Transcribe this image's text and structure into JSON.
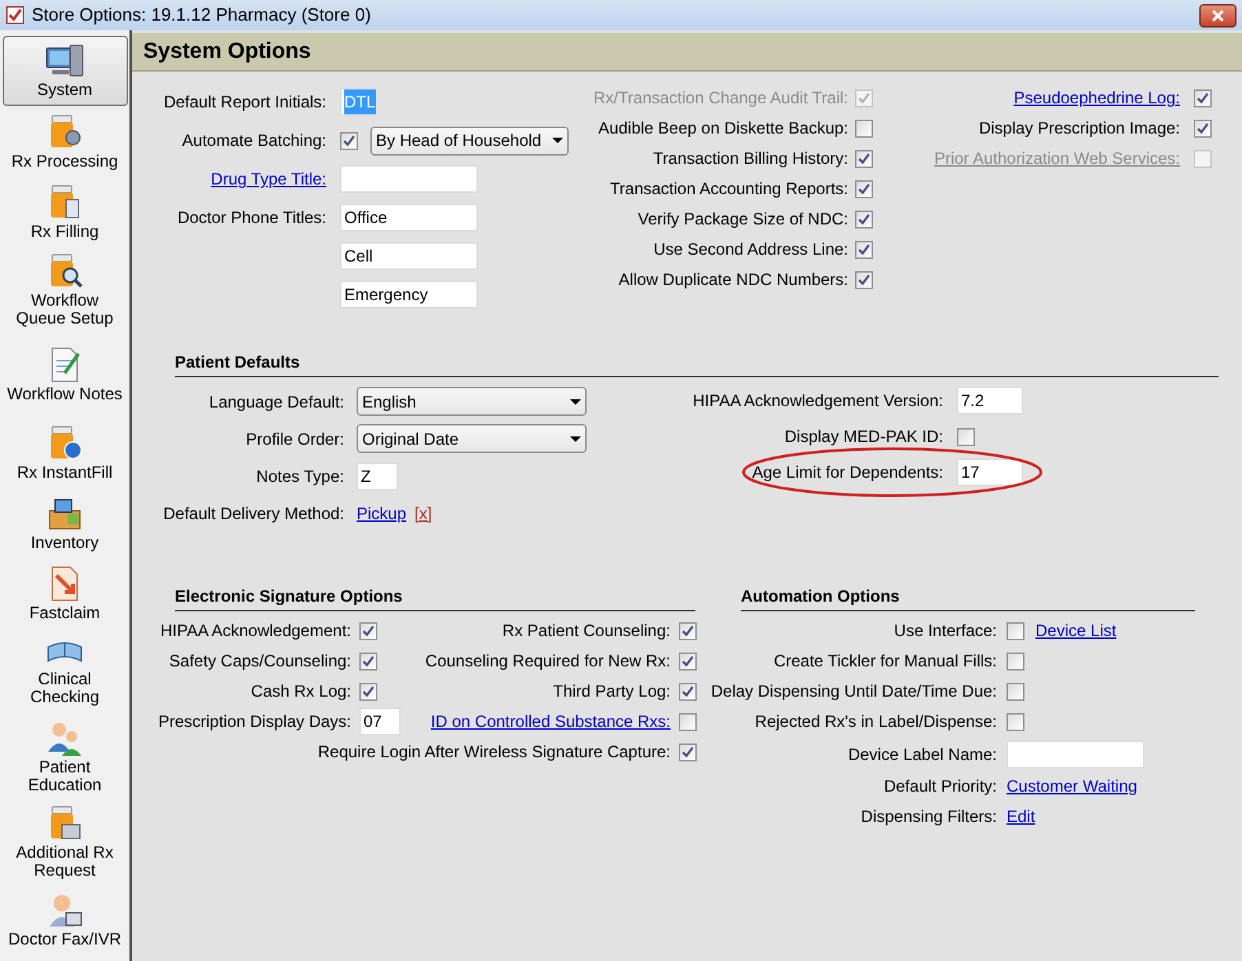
{
  "window": {
    "title": "Store Options: 19.1.12 Pharmacy (Store 0)"
  },
  "sidebar": {
    "items": [
      {
        "label": "System",
        "selected": true
      },
      {
        "label": "Rx Processing",
        "selected": false
      },
      {
        "label": "Rx Filling",
        "selected": false
      },
      {
        "label": "Workflow Queue Setup",
        "selected": false
      },
      {
        "label": "Workflow Notes",
        "selected": false
      },
      {
        "label": "Rx InstantFill",
        "selected": false
      },
      {
        "label": "Inventory",
        "selected": false
      },
      {
        "label": "Fastclaim",
        "selected": false
      },
      {
        "label": "Clinical Checking",
        "selected": false
      },
      {
        "label": "Patient Education",
        "selected": false
      },
      {
        "label": "Additional Rx Request",
        "selected": false
      },
      {
        "label": "Doctor Fax/IVR",
        "selected": false
      }
    ]
  },
  "header": {
    "title": "System Options"
  },
  "general": {
    "left": [
      {
        "kind": "input",
        "label": "Default Report Initials:",
        "link": false,
        "value": "DTL",
        "text_selected": true
      },
      {
        "kind": "checkbox-select",
        "label": "Automate Batching:",
        "link": false,
        "checked": true,
        "value": "By Head of Household"
      },
      {
        "kind": "input",
        "label": "Drug Type Title:",
        "link": true
      },
      {
        "kind": "input",
        "label": "Doctor Phone Titles:",
        "link": false,
        "value": "Office"
      },
      {
        "kind": "input",
        "value": "Cell"
      },
      {
        "kind": "input",
        "value": "Emergency"
      }
    ],
    "middle": [
      {
        "label": "Rx/Transaction Change Audit Trail:",
        "checked": true,
        "disabled": true
      },
      {
        "label": "Audible Beep on Diskette Backup:",
        "checked": false,
        "disabled": false
      },
      {
        "label": "Transaction Billing History:",
        "checked": true,
        "disabled": false
      },
      {
        "label": "Transaction Accounting Reports:",
        "checked": true,
        "disabled": false
      },
      {
        "label": "Verify Package Size of NDC:",
        "checked": true,
        "disabled": false
      },
      {
        "label": "Use Second Address Line:",
        "checked": true,
        "disabled": false
      },
      {
        "label": "Allow Duplicate NDC Numbers:",
        "checked": true,
        "disabled": false
      }
    ],
    "right": [
      {
        "label": "Pseudoephedrine Log:",
        "link": true,
        "checked": true,
        "disabled": false
      },
      {
        "label": "Display Prescription Image:",
        "link": false,
        "checked": true,
        "disabled": false
      },
      {
        "label": "Prior Authorization Web Services:",
        "link": true,
        "checked": false,
        "disabled": true
      }
    ]
  },
  "patient_defaults": {
    "title": "Patient Defaults",
    "left": [
      {
        "kind": "select",
        "label": "Language Default:",
        "value": "English"
      },
      {
        "kind": "select",
        "label": "Profile Order:",
        "value": "Original Date"
      },
      {
        "kind": "input",
        "label": "Notes Type:",
        "value": "Z"
      },
      {
        "kind": "link",
        "label": "Default Delivery Method:",
        "value": "Pickup",
        "remove": "[x]"
      }
    ],
    "right": [
      {
        "kind": "input",
        "label": "HIPAA Acknowledgement Version:",
        "value": "7.2"
      },
      {
        "kind": "checkbox",
        "label": "Display MED-PAK ID:",
        "checked": false
      },
      {
        "kind": "input",
        "label": "Age Limit for Dependents:",
        "value": "17",
        "circled": true
      }
    ]
  },
  "electronic_signature": {
    "title": "Electronic Signature Options",
    "rows": [
      {
        "cells": [
          {
            "kind": "checkbox",
            "label": "HIPAA Acknowledgement:",
            "link": false,
            "checked": true
          },
          {
            "kind": "checkbox",
            "label": "Rx Patient Counseling:",
            "link": false,
            "checked": true
          }
        ]
      },
      {
        "cells": [
          {
            "kind": "checkbox",
            "label": "Safety Caps/Counseling:",
            "link": false,
            "checked": true
          },
          {
            "kind": "checkbox",
            "label": "Counseling Required for New Rx:",
            "link": false,
            "checked": true
          }
        ]
      },
      {
        "cells": [
          {
            "kind": "checkbox",
            "label": "Cash Rx Log:",
            "link": false,
            "checked": true
          },
          {
            "kind": "checkbox",
            "label": "Third Party Log:",
            "link": false,
            "checked": true
          }
        ]
      },
      {
        "cells": [
          {
            "kind": "input",
            "label": "Prescription Display Days:",
            "link": false,
            "value": "07"
          },
          {
            "kind": "checkbox",
            "label": "ID on Controlled Substance Rxs:",
            "link": true,
            "checked": false
          }
        ]
      },
      {
        "cells": [
          {
            "kind": "checkbox",
            "label": "Require Login After Wireless Signature Capture:",
            "link": false,
            "checked": true
          }
        ]
      }
    ]
  },
  "automation": {
    "title": "Automation Options",
    "items": [
      {
        "kind": "checkbox",
        "label": "Use Interface:",
        "checked": false,
        "action": "Device List"
      },
      {
        "kind": "checkbox",
        "label": "Create Tickler for Manual Fills:",
        "checked": false
      },
      {
        "kind": "checkbox",
        "label": "Delay Dispensing Until Date/Time Due:",
        "checked": false
      },
      {
        "kind": "checkbox",
        "label": "Rejected Rx's in Label/Dispense:",
        "checked": false
      },
      {
        "kind": "input",
        "label": "Device Label Name:"
      },
      {
        "kind": "link",
        "label": "Default Priority:",
        "value": "Customer Waiting"
      },
      {
        "kind": "link",
        "label": "Dispensing Filters:",
        "value": "Edit"
      }
    ]
  }
}
